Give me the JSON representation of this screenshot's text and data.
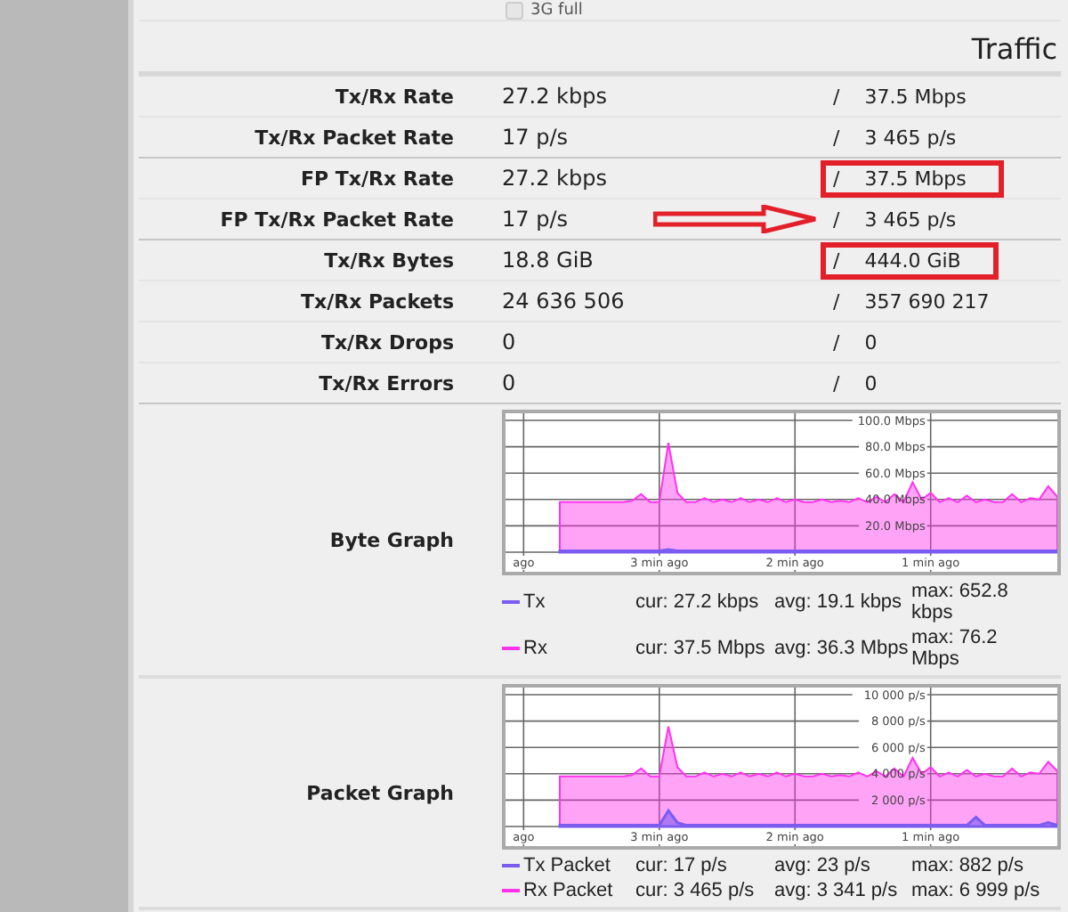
{
  "top_option": {
    "label": "3G full",
    "checked": false
  },
  "section_title": "Traffic",
  "sections": [
    [
      {
        "label": "Tx/Rx Rate",
        "tx": "27.2 kbps",
        "separator": "/",
        "rx": "37.5 Mbps",
        "highlighted": false,
        "arrow": false
      },
      {
        "label": "Tx/Rx Packet Rate",
        "tx": "17 p/s",
        "separator": "/",
        "rx": "3 465 p/s",
        "highlighted": false,
        "arrow": false
      }
    ],
    [
      {
        "label": "FP Tx/Rx Rate",
        "tx": "27.2 kbps",
        "separator": "/",
        "rx": "37.5 Mbps",
        "highlighted": true,
        "arrow": false
      },
      {
        "label": "FP Tx/Rx Packet Rate",
        "tx": "17 p/s",
        "separator": "/",
        "rx": "3 465 p/s",
        "highlighted": false,
        "arrow": true
      }
    ],
    [
      {
        "label": "Tx/Rx Bytes",
        "tx": "18.8 GiB",
        "separator": "/",
        "rx": "444.0 GiB",
        "highlighted": true,
        "arrow": false
      },
      {
        "label": "Tx/Rx Packets",
        "tx": "24 636 506",
        "separator": "/",
        "rx": "357 690 217",
        "highlighted": false,
        "arrow": false
      },
      {
        "label": "Tx/Rx Drops",
        "tx": "0",
        "separator": "/",
        "rx": "0",
        "highlighted": false,
        "arrow": false
      },
      {
        "label": "Tx/Rx Errors",
        "tx": "0",
        "separator": "/",
        "rx": "0",
        "highlighted": false,
        "arrow": false
      }
    ]
  ],
  "graphs": [
    {
      "label": "Byte Graph",
      "chart_data": {
        "type": "area",
        "categories": [
          null,
          null,
          "ago",
          null,
          null,
          null,
          null,
          null,
          null,
          null,
          null,
          null,
          null,
          null,
          null,
          null,
          null,
          "3 min ago",
          null,
          null,
          null,
          null,
          null,
          null,
          null,
          null,
          null,
          null,
          null,
          null,
          null,
          null,
          "2 min ago",
          null,
          null,
          null,
          null,
          null,
          null,
          null,
          null,
          null,
          null,
          null,
          null,
          null,
          null,
          "1 min ago",
          null,
          null,
          null,
          null,
          null,
          null,
          null,
          null,
          null,
          null,
          null,
          null,
          null,
          null
        ],
        "ylim": [
          0,
          100
        ],
        "grid": true,
        "yticks": [
          {
            "value": 20,
            "label": "20.0 Mbps"
          },
          {
            "value": 40,
            "label": "40.0 Mbps"
          },
          {
            "value": 60,
            "label": "60.0 Mbps"
          },
          {
            "value": 80,
            "label": "80.0 Mbps"
          },
          {
            "value": 100,
            "label": "100.0 Mbps"
          }
        ],
        "series": [
          {
            "name": "Tx",
            "color": "#7b5cf0",
            "values": [
              null,
              null,
              null,
              null,
              null,
              null,
              1,
              1,
              1,
              1,
              1,
              1,
              1,
              1,
              1,
              1,
              1,
              1,
              2,
              1,
              1,
              1,
              1,
              1,
              1,
              1,
              1,
              1,
              1,
              1,
              1,
              1,
              1,
              1,
              1,
              1,
              1,
              1,
              1,
              1,
              1,
              1,
              1,
              1,
              1,
              1,
              1,
              1,
              1,
              1,
              1,
              1,
              1,
              1,
              1,
              1,
              1,
              1,
              1,
              1,
              1,
              1
            ]
          },
          {
            "name": "Rx",
            "color": "#ff33ee",
            "values": [
              null,
              null,
              null,
              null,
              null,
              null,
              38,
              38,
              38,
              38,
              38,
              38,
              38,
              38,
              39,
              44,
              38,
              38,
              83,
              45,
              38,
              38,
              41,
              38,
              40,
              38,
              41,
              38,
              40,
              38,
              41,
              38,
              40,
              38,
              38,
              40,
              38,
              39,
              38,
              41,
              38,
              42,
              38,
              44,
              38,
              53,
              40,
              45,
              38,
              41,
              38,
              43,
              38,
              40,
              38,
              38,
              44,
              38,
              41,
              40,
              50,
              42
            ]
          }
        ]
      },
      "legend": [
        {
          "cur": "cur: 27.2 kbps",
          "avg": "avg: 19.1 kbps",
          "max": "max: 652.8 kbps"
        },
        {
          "cur": "cur: 37.5 Mbps",
          "avg": "avg: 36.3 Mbps",
          "max": "max: 76.2 Mbps"
        }
      ]
    },
    {
      "label": "Packet Graph",
      "chart_data": {
        "type": "area",
        "categories": [
          null,
          null,
          "ago",
          null,
          null,
          null,
          null,
          null,
          null,
          null,
          null,
          null,
          null,
          null,
          null,
          null,
          null,
          "3 min ago",
          null,
          null,
          null,
          null,
          null,
          null,
          null,
          null,
          null,
          null,
          null,
          null,
          null,
          null,
          "2 min ago",
          null,
          null,
          null,
          null,
          null,
          null,
          null,
          null,
          null,
          null,
          null,
          null,
          null,
          null,
          "1 min ago",
          null,
          null,
          null,
          null,
          null,
          null,
          null,
          null,
          null,
          null,
          null,
          null,
          null,
          null
        ],
        "ylim": [
          0,
          10000
        ],
        "grid": true,
        "yticks": [
          {
            "value": 2000,
            "label": "2 000 p/s"
          },
          {
            "value": 4000,
            "label": "4 000 p/s"
          },
          {
            "value": 6000,
            "label": "6 000 p/s"
          },
          {
            "value": 8000,
            "label": "8 000 p/s"
          },
          {
            "value": 10000,
            "label": "10 000 p/s"
          }
        ],
        "series": [
          {
            "name": "Tx Packet",
            "color": "#7b5cf0",
            "values": [
              null,
              null,
              null,
              null,
              null,
              null,
              100,
              100,
              100,
              100,
              100,
              100,
              100,
              100,
              100,
              100,
              100,
              100,
              1200,
              300,
              100,
              100,
              100,
              100,
              100,
              100,
              100,
              100,
              100,
              100,
              100,
              100,
              100,
              100,
              100,
              100,
              100,
              100,
              100,
              100,
              100,
              100,
              100,
              100,
              100,
              100,
              100,
              100,
              100,
              100,
              100,
              100,
              700,
              100,
              100,
              100,
              100,
              100,
              100,
              100,
              300,
              100
            ]
          },
          {
            "name": "Rx Packet",
            "color": "#ff33ee",
            "values": [
              null,
              null,
              null,
              null,
              null,
              null,
              3800,
              3800,
              3800,
              3800,
              3800,
              3800,
              3800,
              3800,
              3900,
              4400,
              3800,
              3800,
              7600,
              4500,
              3800,
              3800,
              4100,
              3800,
              4000,
              3800,
              4100,
              3800,
              4000,
              3800,
              4100,
              3800,
              4000,
              3800,
              3800,
              4000,
              3800,
              3900,
              3800,
              4100,
              3800,
              4200,
              3800,
              4400,
              3800,
              5200,
              4000,
              4500,
              3800,
              4100,
              3800,
              4300,
              3800,
              4000,
              3800,
              3800,
              4400,
              3800,
              4100,
              4000,
              4900,
              4200
            ]
          }
        ]
      },
      "legend": [
        {
          "cur": "cur: 17 p/s",
          "avg": "avg: 23 p/s",
          "max": "max: 882 p/s"
        },
        {
          "cur": "cur: 3 465 p/s",
          "avg": "avg: 3 341 p/s",
          "max": "max: 6 999 p/s"
        }
      ]
    }
  ]
}
